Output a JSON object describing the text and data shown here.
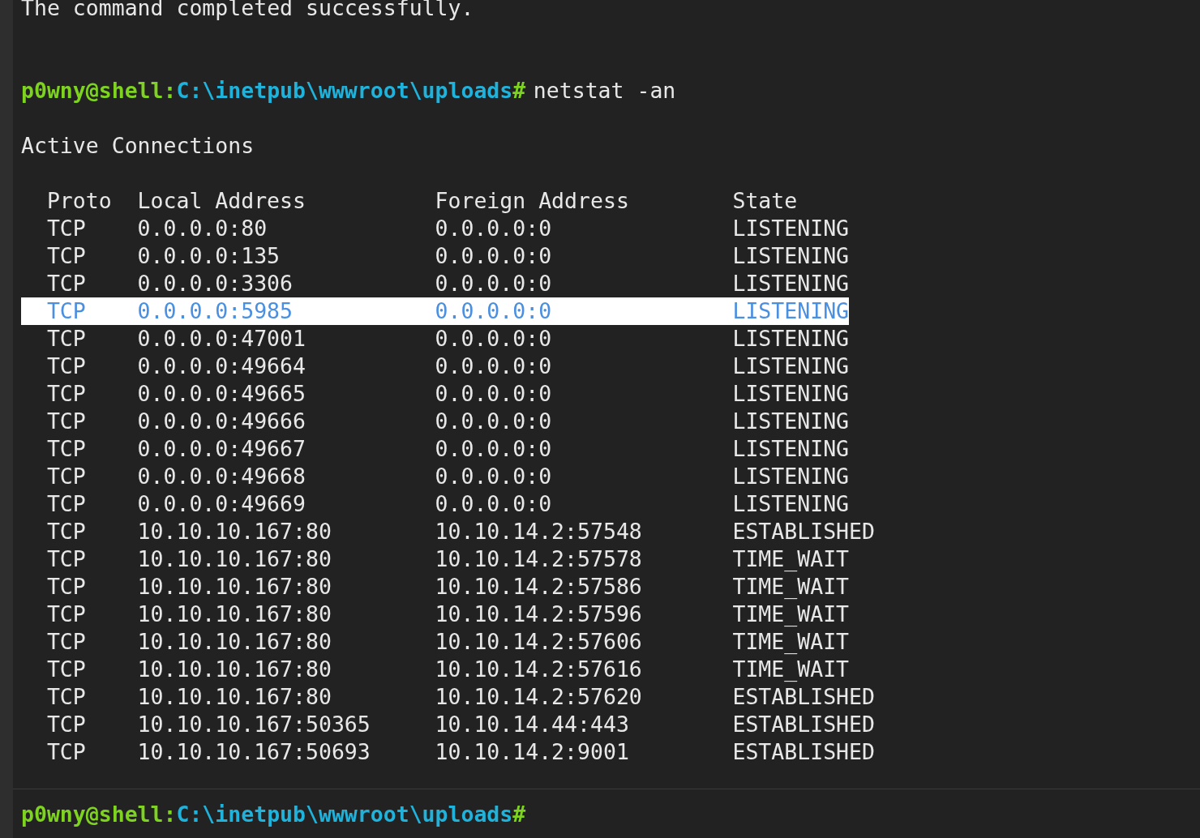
{
  "output": {
    "previous_result": "The command completed successfully.",
    "prompt": {
      "user": "p0wny@shell:",
      "path": "C:\\inetpub\\wwwroot\\uploads",
      "symbol": "#"
    },
    "command": "netstat -an",
    "heading": "Active Connections",
    "table": {
      "columns": [
        "Proto",
        "Local Address",
        "Foreign Address",
        "State"
      ],
      "rows": [
        {
          "proto": "TCP",
          "local": "0.0.0.0:80",
          "foreign": "0.0.0.0:0",
          "state": "LISTENING",
          "selected": false
        },
        {
          "proto": "TCP",
          "local": "0.0.0.0:135",
          "foreign": "0.0.0.0:0",
          "state": "LISTENING",
          "selected": false
        },
        {
          "proto": "TCP",
          "local": "0.0.0.0:3306",
          "foreign": "0.0.0.0:0",
          "state": "LISTENING",
          "selected": false
        },
        {
          "proto": "TCP",
          "local": "0.0.0.0:5985",
          "foreign": "0.0.0.0:0",
          "state": "LISTENING",
          "selected": true
        },
        {
          "proto": "TCP",
          "local": "0.0.0.0:47001",
          "foreign": "0.0.0.0:0",
          "state": "LISTENING",
          "selected": false
        },
        {
          "proto": "TCP",
          "local": "0.0.0.0:49664",
          "foreign": "0.0.0.0:0",
          "state": "LISTENING",
          "selected": false
        },
        {
          "proto": "TCP",
          "local": "0.0.0.0:49665",
          "foreign": "0.0.0.0:0",
          "state": "LISTENING",
          "selected": false
        },
        {
          "proto": "TCP",
          "local": "0.0.0.0:49666",
          "foreign": "0.0.0.0:0",
          "state": "LISTENING",
          "selected": false
        },
        {
          "proto": "TCP",
          "local": "0.0.0.0:49667",
          "foreign": "0.0.0.0:0",
          "state": "LISTENING",
          "selected": false
        },
        {
          "proto": "TCP",
          "local": "0.0.0.0:49668",
          "foreign": "0.0.0.0:0",
          "state": "LISTENING",
          "selected": false
        },
        {
          "proto": "TCP",
          "local": "0.0.0.0:49669",
          "foreign": "0.0.0.0:0",
          "state": "LISTENING",
          "selected": false
        },
        {
          "proto": "TCP",
          "local": "10.10.10.167:80",
          "foreign": "10.10.14.2:57548",
          "state": "ESTABLISHED",
          "selected": false
        },
        {
          "proto": "TCP",
          "local": "10.10.10.167:80",
          "foreign": "10.10.14.2:57578",
          "state": "TIME_WAIT",
          "selected": false
        },
        {
          "proto": "TCP",
          "local": "10.10.10.167:80",
          "foreign": "10.10.14.2:57586",
          "state": "TIME_WAIT",
          "selected": false
        },
        {
          "proto": "TCP",
          "local": "10.10.10.167:80",
          "foreign": "10.10.14.2:57596",
          "state": "TIME_WAIT",
          "selected": false
        },
        {
          "proto": "TCP",
          "local": "10.10.10.167:80",
          "foreign": "10.10.14.2:57606",
          "state": "TIME_WAIT",
          "selected": false
        },
        {
          "proto": "TCP",
          "local": "10.10.10.167:80",
          "foreign": "10.10.14.2:57616",
          "state": "TIME_WAIT",
          "selected": false
        },
        {
          "proto": "TCP",
          "local": "10.10.10.167:80",
          "foreign": "10.10.14.2:57620",
          "state": "ESTABLISHED",
          "selected": false
        },
        {
          "proto": "TCP",
          "local": "10.10.10.167:50365",
          "foreign": "10.10.14.44:443",
          "state": "ESTABLISHED",
          "selected": false
        },
        {
          "proto": "TCP",
          "local": "10.10.10.167:50693",
          "foreign": "10.10.14.2:9001",
          "state": "ESTABLISHED",
          "selected": false
        }
      ]
    }
  },
  "input": {
    "prompt": {
      "user": "p0wny@shell:",
      "path": "C:\\inetpub\\wwwroot\\uploads",
      "symbol": "#"
    }
  }
}
